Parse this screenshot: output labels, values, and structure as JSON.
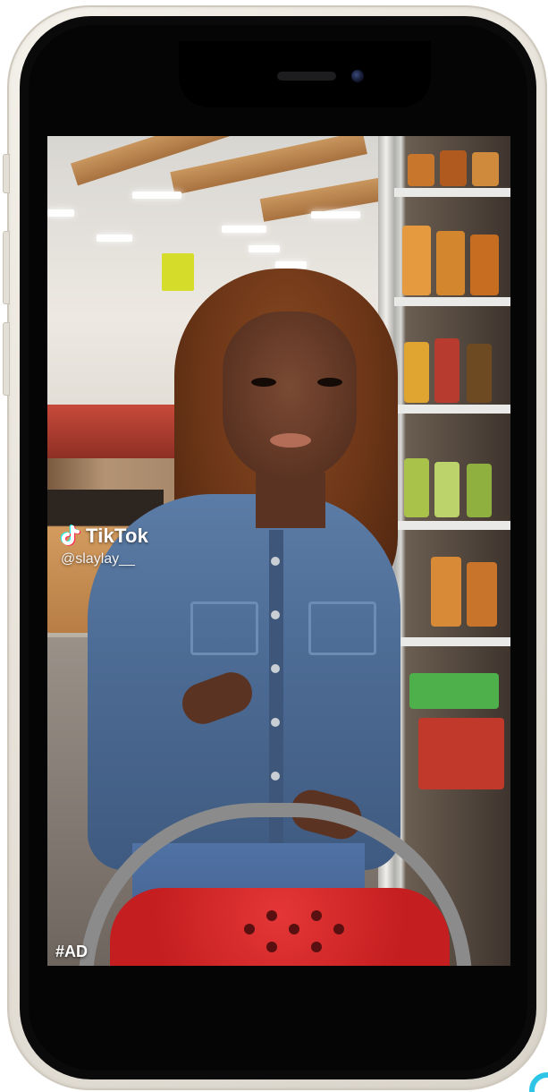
{
  "video": {
    "platform_brand": "TikTok",
    "creator_handle": "@slaylay__",
    "ad_label": "#AD"
  },
  "colors": {
    "phone_frame": "#e7e3da",
    "bezel": "#0a0a0b",
    "tiktok_text": "#ffffff",
    "tiktok_cyan": "#25f4ee",
    "tiktok_pink": "#fe2c55",
    "basket_red": "#c41e20",
    "corner_accent": "#2ec4e6"
  },
  "icons": {
    "tiktok_logo": "tiktok-note-icon",
    "camera": "front-camera-icon"
  }
}
